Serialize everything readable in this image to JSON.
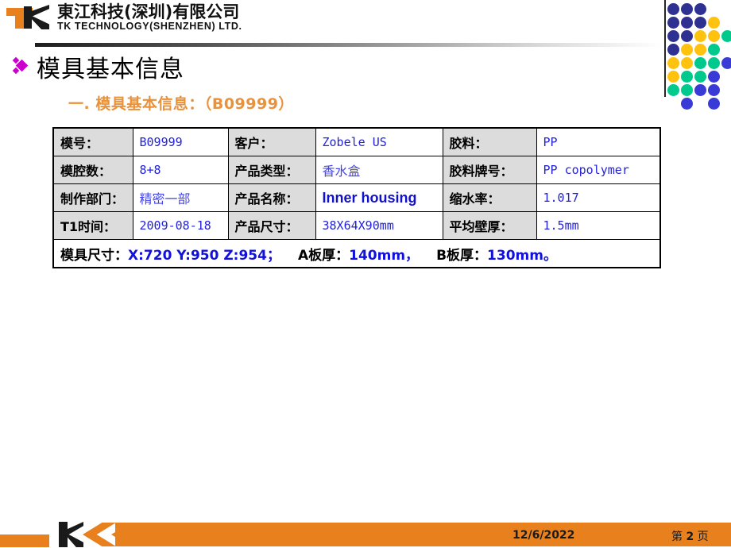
{
  "brand": {
    "logo_cn": "東江科技(深圳)有限公司",
    "logo_en": "TK TECHNOLOGY(SHENZHEN) LTD.",
    "orange": "#E8801E",
    "black": "#1a1a1a"
  },
  "title": {
    "bullet": "diamond-bullet",
    "text": "模具基本信息"
  },
  "section": {
    "heading": "一. 模具基本信息：（B09999）",
    "color": "#E8923C"
  },
  "table": {
    "rows": [
      {
        "label1": "模号：",
        "value1": "B09999",
        "label2": "客户：",
        "value2": "Zobele US",
        "label3": "胶料：",
        "value3": "PP"
      },
      {
        "label1": "模腔数：",
        "value1": "8+8",
        "label2": "产品类型：",
        "value2": "香水盒",
        "label3": "胶料牌号：",
        "value3": "PP copolymer"
      },
      {
        "label1": "制作部门：",
        "value1": "精密一部",
        "label2": "产品名称：",
        "value2": "Inner housing",
        "label3": "缩水率：",
        "value3": "1.017"
      },
      {
        "label1": "T1时间：",
        "value1": "2009-08-18",
        "label2": "产品尺寸：",
        "value2": "38X64X90mm",
        "label3": "平均壁厚：",
        "value3": "1.5mm"
      }
    ],
    "summary": {
      "mold_size_label": "模具尺寸：",
      "mold_size_value": "X:720 Y:950 Z:954；",
      "plate_a_label": "A板厚：",
      "plate_a_value": "140mm，",
      "plate_b_label": "B板厚：",
      "plate_b_value": "130mm。"
    }
  },
  "dotgrid": {
    "colors": {
      "blue": "#2E3192",
      "yellow": "#FFC20E",
      "green": "#00C98D",
      "indigo": "#3A3AD6"
    },
    "dots": [
      {
        "col": 0,
        "row": 0,
        "color": "#2E3192"
      },
      {
        "col": 1,
        "row": 0,
        "color": "#2E3192"
      },
      {
        "col": 2,
        "row": 0,
        "color": "#2E3192"
      },
      {
        "col": 0,
        "row": 1,
        "color": "#2E3192"
      },
      {
        "col": 1,
        "row": 1,
        "color": "#2E3192"
      },
      {
        "col": 2,
        "row": 1,
        "color": "#2E3192"
      },
      {
        "col": 3,
        "row": 1,
        "color": "#FFC20E"
      },
      {
        "col": 0,
        "row": 2,
        "color": "#2E3192"
      },
      {
        "col": 1,
        "row": 2,
        "color": "#2E3192"
      },
      {
        "col": 2,
        "row": 2,
        "color": "#FFC20E"
      },
      {
        "col": 3,
        "row": 2,
        "color": "#FFC20E"
      },
      {
        "col": 4,
        "row": 2,
        "color": "#00C98D"
      },
      {
        "col": 0,
        "row": 3,
        "color": "#2E3192"
      },
      {
        "col": 1,
        "row": 3,
        "color": "#FFC20E"
      },
      {
        "col": 2,
        "row": 3,
        "color": "#FFC20E"
      },
      {
        "col": 3,
        "row": 3,
        "color": "#00C98D"
      },
      {
        "col": 0,
        "row": 4,
        "color": "#FFC20E"
      },
      {
        "col": 1,
        "row": 4,
        "color": "#FFC20E"
      },
      {
        "col": 2,
        "row": 4,
        "color": "#00C98D"
      },
      {
        "col": 3,
        "row": 4,
        "color": "#00C98D"
      },
      {
        "col": 4,
        "row": 4,
        "color": "#3A3AD6"
      },
      {
        "col": 0,
        "row": 5,
        "color": "#FFC20E"
      },
      {
        "col": 1,
        "row": 5,
        "color": "#00C98D"
      },
      {
        "col": 2,
        "row": 5,
        "color": "#00C98D"
      },
      {
        "col": 3,
        "row": 5,
        "color": "#3A3AD6"
      },
      {
        "col": 0,
        "row": 6,
        "color": "#00C98D"
      },
      {
        "col": 1,
        "row": 6,
        "color": "#00C98D"
      },
      {
        "col": 2,
        "row": 6,
        "color": "#3A3AD6"
      },
      {
        "col": 3,
        "row": 6,
        "color": "#3A3AD6"
      },
      {
        "col": 1,
        "row": 7,
        "color": "#3A3AD6"
      },
      {
        "col": 3,
        "row": 7,
        "color": "#3A3AD6"
      }
    ]
  },
  "footer": {
    "date": "12/6/2022",
    "page_prefix": "第",
    "page_number": "2",
    "page_suffix": "页"
  }
}
